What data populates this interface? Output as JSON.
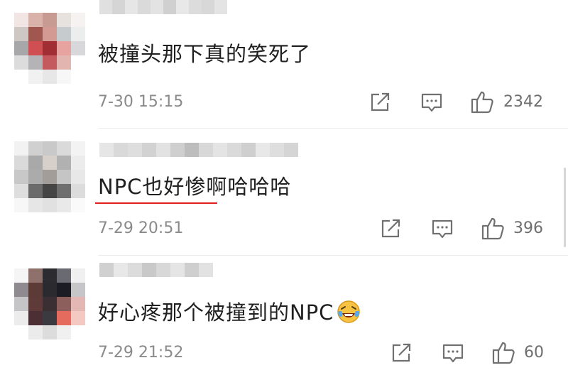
{
  "comments": [
    {
      "text": "被撞头那下真的笑死了",
      "time": "7-30 15:15",
      "likes": "2342",
      "avatar_colors": [
        "#f2e6e4",
        "#d9b3aa",
        "#c89b92",
        "#e8e2df",
        "#f5f2f1",
        "#cfc7c3",
        "#a0574f",
        "#d39a93",
        "#c6cccd",
        "#eceeee",
        "#a7a6a8",
        "#cf4f52",
        "#a12e33",
        "#e6a3a0",
        "#d8d8da",
        "#dcdcdc",
        "#b4b3b6",
        "#c45a5e",
        "#e3b5b1",
        "#ffffff",
        "#ffffff",
        "#f1f1f1",
        "#e8e7e8",
        "#f7f7f7",
        "#ffffff"
      ],
      "username_colors": [
        "#e0e0e0",
        "#d5d5d5",
        "#e6e6e6",
        "#dadada",
        "#e3e3e3",
        "#d0d0d0",
        "#e8e8e8",
        "#dcdcdc",
        "#d8d8d8",
        "#e4e4e4"
      ]
    },
    {
      "text": "NPC也好惨啊哈哈哈",
      "time": "7-29 20:51",
      "likes": "396",
      "avatar_colors": [
        "#f2f2f2",
        "#d0d0d0",
        "#c9c9c9",
        "#dadada",
        "#f3f3f3",
        "#dadada",
        "#a9a9a9",
        "#d7cfc9",
        "#b1b1b1",
        "#ececec",
        "#c8c8c8",
        "#ababab",
        "#a39d99",
        "#c5c5c5",
        "#e8e8e8",
        "#dedede",
        "#6b6b6b",
        "#454545",
        "#6e6e6e",
        "#dcdcdc",
        "#f7f7f7",
        "#e6e6e6",
        "#e1e1e1",
        "#e9e9e9",
        "#fafafa"
      ],
      "username_colors": [
        "#e6e6e6",
        "#d9d9d9",
        "#dedede",
        "#d2d2d2",
        "#e2e2e2",
        "#cfcfcf",
        "#bdbdbd",
        "#d8d8d8",
        "#e4e4e4",
        "#dadada",
        "#cfcfcf",
        "#e8e8e8",
        "#dedede",
        "#d5d5d5"
      ]
    },
    {
      "text": "好心疼那个被撞到的NPC",
      "time": "7-29 21:52",
      "likes": "60",
      "avatar_colors": [
        "#f5f5f5",
        "#8f716b",
        "#2b2b30",
        "#6a6a72",
        "#f0f0f0",
        "#8e8a90",
        "#5c3a36",
        "#2a2a2f",
        "#1c1c24",
        "#c6c6c8",
        "#c5c5c8",
        "#5e3b39",
        "#3b2f33",
        "#8d5f5c",
        "#e3b8b4",
        "#ececec",
        "#4b2f35",
        "#3a3a40",
        "#e56b5f",
        "#f4c9c2",
        "#ffffff",
        "#ebebeb",
        "#dcdcdc",
        "#f0f0f0",
        "#ffffff"
      ],
      "username_colors": [
        "#d0d0d0",
        "#e8e8e8",
        "#dcdcdc",
        "#c9c9c9",
        "#d8d8d8",
        "#e5e5e5",
        "#cfcfcf",
        "#e2e2e2"
      ]
    }
  ],
  "icons": {
    "share": "share-icon",
    "reply": "comment-icon",
    "like": "thumbs-up-icon"
  }
}
